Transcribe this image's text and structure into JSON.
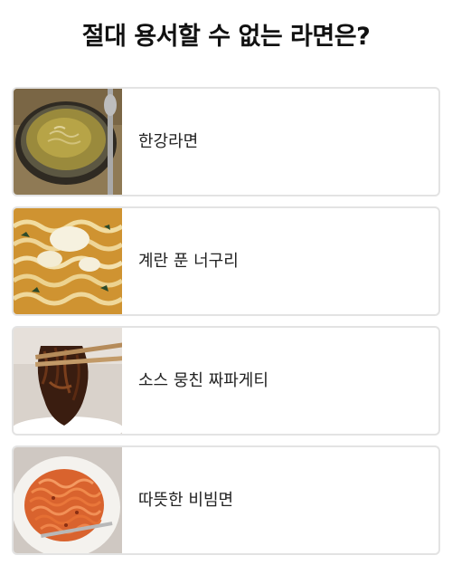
{
  "title": "절대 용서할 수 없는 라면은?",
  "options": [
    {
      "label": "한강라면",
      "icon": "ramen-bowl-photo"
    },
    {
      "label": "계란 푼 너구리",
      "icon": "egg-noodle-photo"
    },
    {
      "label": "소스 뭉친 짜파게티",
      "icon": "jjapaghetti-photo"
    },
    {
      "label": "따뜻한 비빔면",
      "icon": "bibimmyeon-photo"
    }
  ]
}
